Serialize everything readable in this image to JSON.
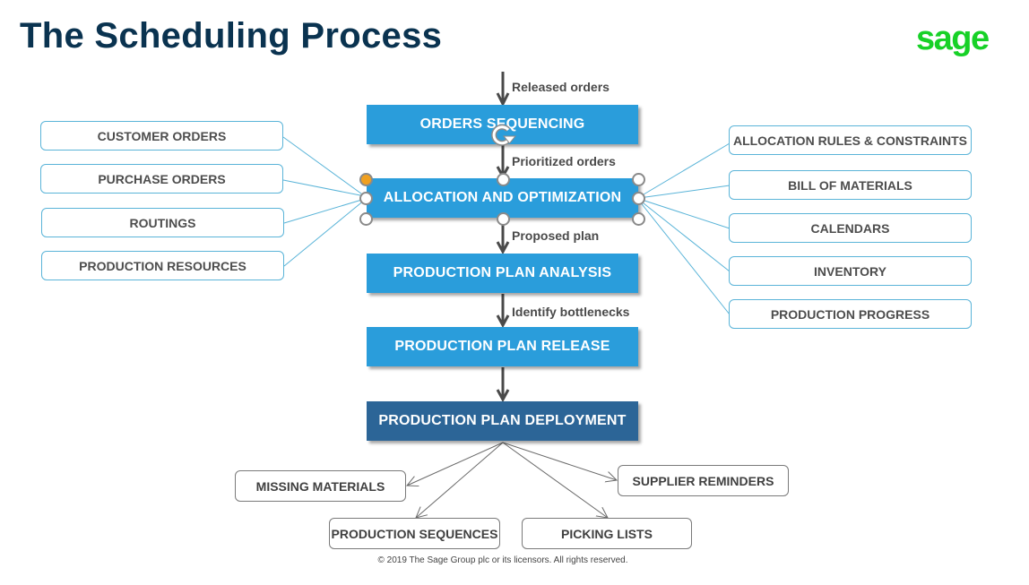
{
  "header": {
    "title": "The Scheduling Process",
    "logo": "sage"
  },
  "colors": {
    "title": "#0a3350",
    "logo": "#17d127",
    "step": "#2a9ddb",
    "step_final": "#2c6597",
    "input_border": "#5ab4d8",
    "output_border": "#7a7a7a",
    "selection_handle_active": "#f0a020"
  },
  "flow": {
    "entry_label": "Released orders",
    "steps": [
      {
        "label": "ORDERS SEQUENCING"
      },
      {
        "label": "ALLOCATION AND OPTIMIZATION",
        "selected": true
      },
      {
        "label": "PRODUCTION PLAN ANALYSIS"
      },
      {
        "label": "PRODUCTION PLAN RELEASE"
      },
      {
        "label": "PRODUCTION PLAN DEPLOYMENT"
      }
    ],
    "transitions": [
      "Prioritized orders",
      "Proposed plan",
      "Identify bottlenecks",
      ""
    ]
  },
  "inputs_left": [
    "CUSTOMER ORDERS",
    "PURCHASE ORDERS",
    "ROUTINGS",
    "PRODUCTION RESOURCES"
  ],
  "inputs_right": [
    "ALLOCATION RULES & CONSTRAINTS",
    "BILL OF MATERIALS",
    "CALENDARS",
    "INVENTORY",
    "PRODUCTION PROGRESS"
  ],
  "outputs": [
    "MISSING MATERIALS",
    "SUPPLIER REMINDERS",
    "PRODUCTION SEQUENCES",
    "PICKING LISTS"
  ],
  "footer": "© 2019 The Sage Group plc or its licensors. All rights reserved.",
  "icons": {
    "rotate_handle": "rotate-icon"
  }
}
